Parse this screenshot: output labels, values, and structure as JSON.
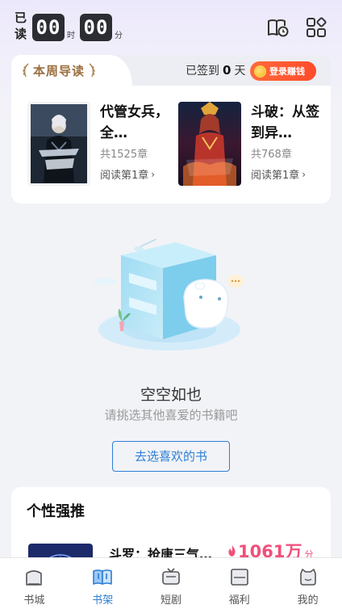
{
  "status": {
    "read_label": "已读",
    "hours": "00",
    "hours_unit": "时",
    "minutes": "00",
    "minutes_unit": "分",
    "top_icons": [
      "book-clock-icon",
      "grid-apps-icon"
    ]
  },
  "weekly": {
    "title": "本周导读",
    "signin_prefix": "已签到",
    "signin_days": "0",
    "signin_suffix": "天",
    "login_button": "登录赚钱",
    "books": [
      {
        "title": "代管女兵，全…",
        "chapters": "共1525章",
        "read_label": "阅读第1章",
        "cover_icon": "dark-armor-cover"
      },
      {
        "title": "斗破：从签到异…",
        "chapters": "共768章",
        "read_label": "阅读第1章",
        "cover_icon": "fire-girl-cover"
      }
    ]
  },
  "empty_state": {
    "title": "空空如也",
    "subtitle": "请挑选其他喜爱的书籍吧",
    "button": "去选喜欢的书"
  },
  "recommend": {
    "section_title": "个性强推",
    "book_title": "斗罗：抢唐三气…",
    "hot_value": "1061万",
    "hot_unit": "分"
  },
  "nav": {
    "items": [
      {
        "label": "书城",
        "icon": "bookstore-icon",
        "active": false
      },
      {
        "label": "书架",
        "icon": "bookshelf-icon",
        "active": true
      },
      {
        "label": "短剧",
        "icon": "tv-icon",
        "active": false
      },
      {
        "label": "福利",
        "icon": "gift-icon",
        "active": false
      },
      {
        "label": "我的",
        "icon": "profile-icon",
        "active": false
      }
    ]
  },
  "colors": {
    "accent": "#2d7fd6",
    "login_button": "#ff5530",
    "weekly_title": "#9a6e3f",
    "hot": "#f0507b"
  }
}
